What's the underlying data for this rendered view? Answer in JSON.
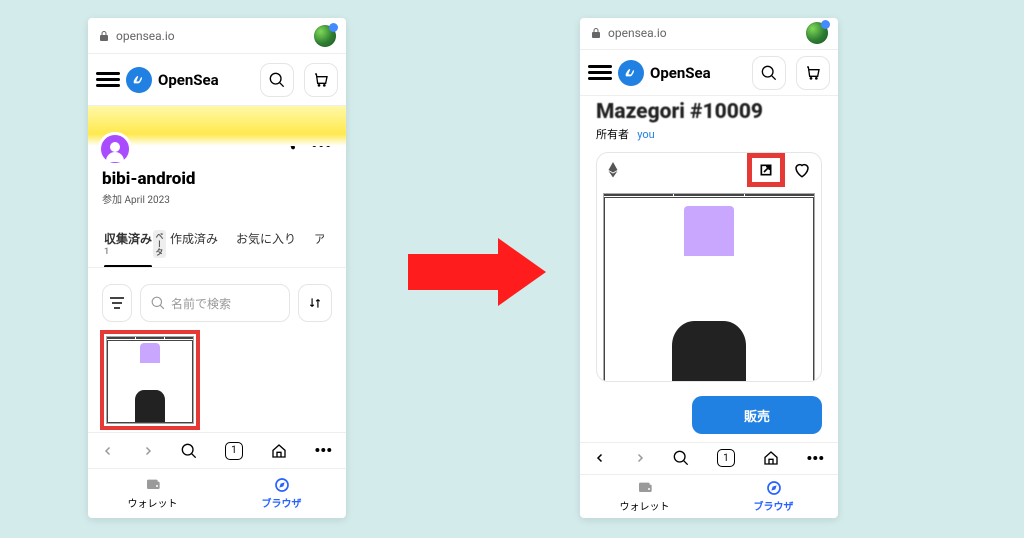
{
  "url_bar": {
    "url": "opensea.io"
  },
  "brand": "OpenSea",
  "left": {
    "username": "bibi-android",
    "joined_prefix": "参加",
    "joined_date": "April 2023",
    "tabs": {
      "collected": "収集済み",
      "collected_count": "1",
      "beta": "ベータ",
      "created": "作成済み",
      "favorites": "お気に入り",
      "activity_cut": "アイ"
    },
    "search_placeholder": "名前で検索",
    "tab_count": "1"
  },
  "right": {
    "item_title": "Mazegori #10009",
    "owner_label": "所有者",
    "owner_link": "you",
    "sell_label": "販売",
    "tab_count": "1"
  },
  "bottom_tabs": {
    "wallet": "ウォレット",
    "browser": "ブラウザ"
  }
}
